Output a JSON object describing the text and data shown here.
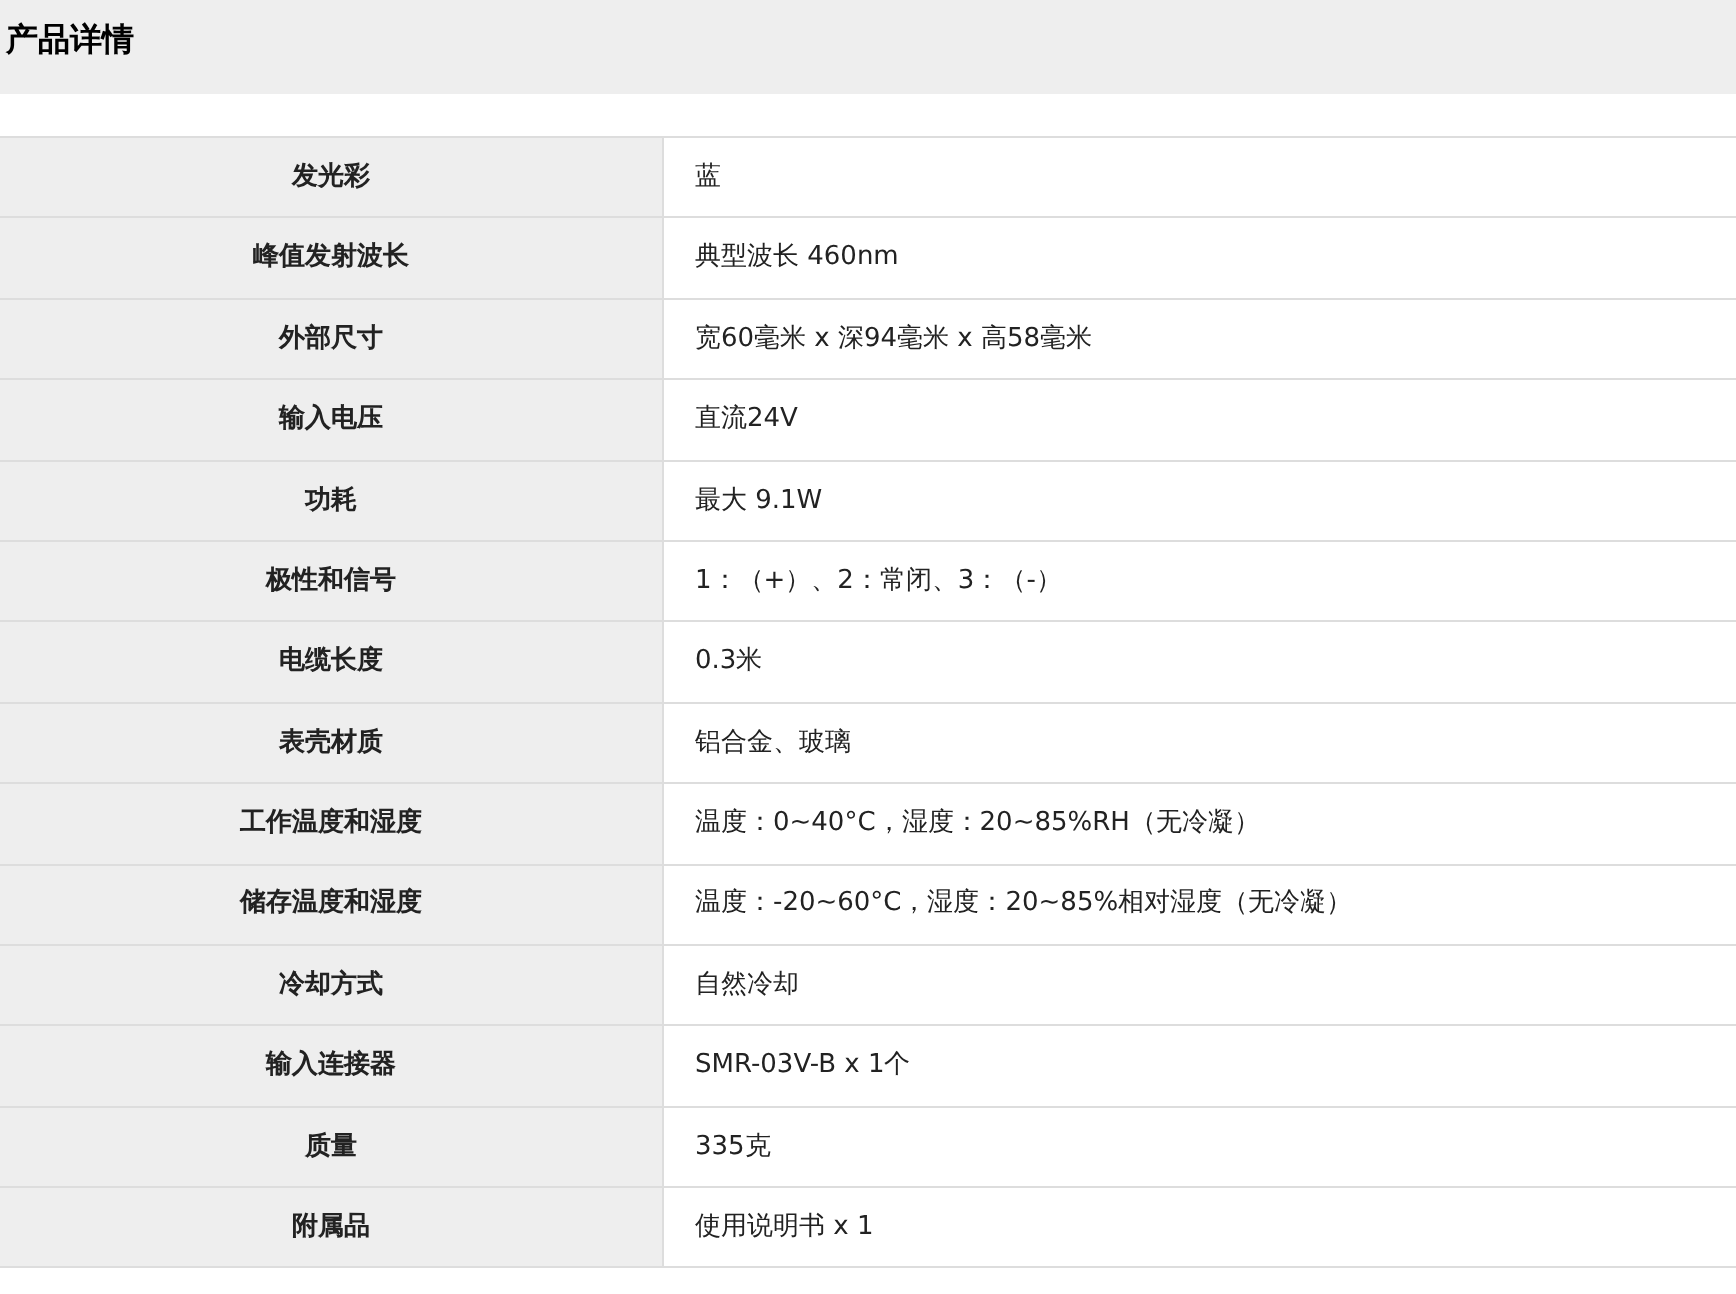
{
  "section": {
    "title": "产品详情"
  },
  "specs": [
    {
      "label": "发光彩",
      "value": "蓝"
    },
    {
      "label": "峰值发射波长",
      "value": "典型波长 460nm"
    },
    {
      "label": "外部尺寸",
      "value": "宽60毫米 x 深94毫米 x 高58毫米"
    },
    {
      "label": "输入电压",
      "value": "直流24V"
    },
    {
      "label": "功耗",
      "value": "最大 9.1W"
    },
    {
      "label": "极性和信号",
      "value": "1：（+）、2：常闭、3：（-）"
    },
    {
      "label": "电缆长度",
      "value": "0.3米"
    },
    {
      "label": "表壳材质",
      "value": "铝合金、玻璃"
    },
    {
      "label": "工作温度和湿度",
      "value": "温度：0~40°C，湿度：20~85%RH（无冷凝）"
    },
    {
      "label": "储存温度和湿度",
      "value": "温度：-20~60°C，湿度：20~85%相对湿度（无冷凝）"
    },
    {
      "label": "冷却方式",
      "value": "自然冷却"
    },
    {
      "label": "输入连接器",
      "value": "SMR-03V-B x 1个"
    },
    {
      "label": "质量",
      "value": "335克"
    },
    {
      "label": "附属品",
      "value": "使用说明书 x 1"
    }
  ]
}
